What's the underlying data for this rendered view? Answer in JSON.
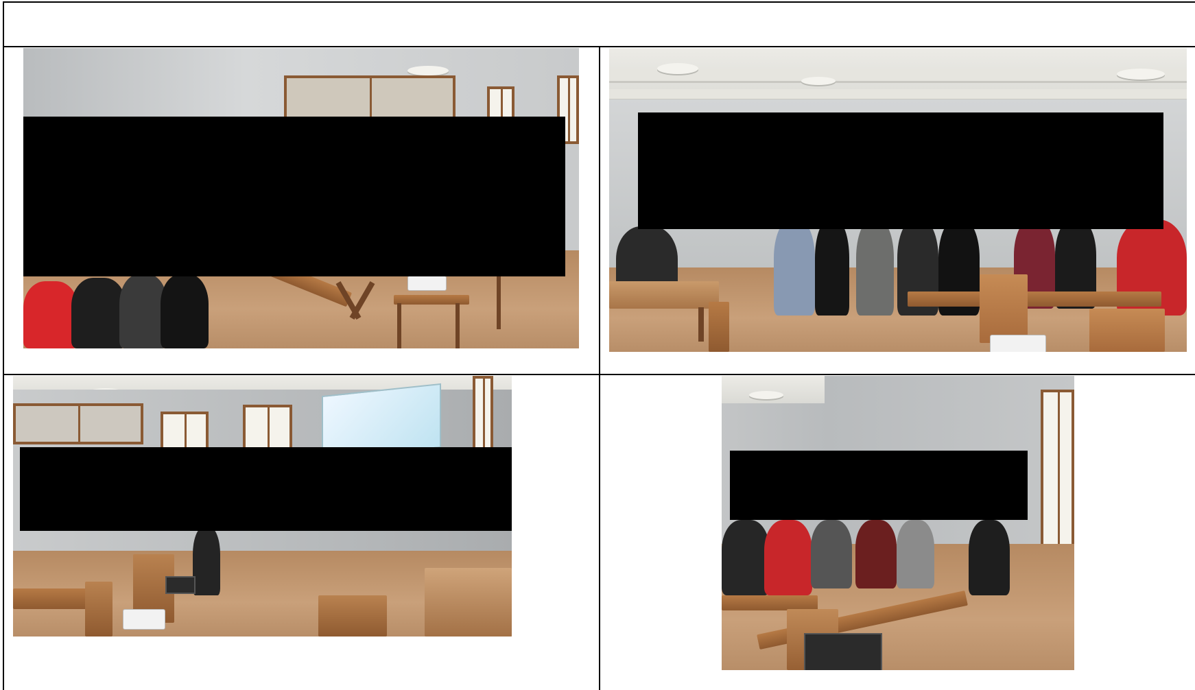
{
  "document": {
    "header_row_text": "",
    "photos": [
      {
        "id": "photo-1",
        "redacted": true
      },
      {
        "id": "photo-2",
        "redacted": true
      },
      {
        "id": "photo-3",
        "redacted": true
      },
      {
        "id": "photo-4",
        "redacted": true
      }
    ]
  },
  "colors": {
    "rule": "#000000",
    "redaction": "#000000",
    "wall": "#c9cbcc",
    "floor": "#c29772",
    "wood": "#9b6236"
  }
}
